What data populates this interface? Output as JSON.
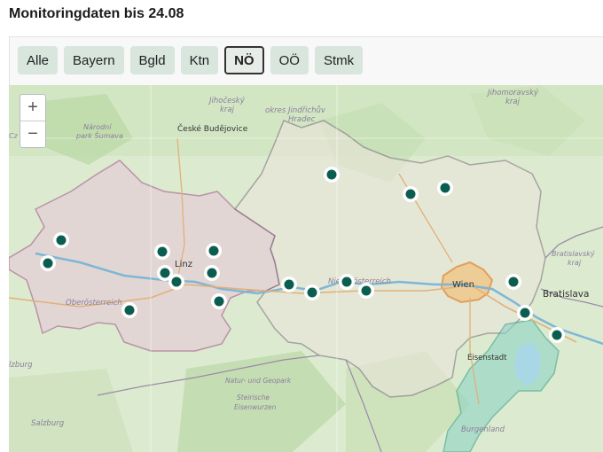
{
  "title": "Monitoringdaten bis 24.08",
  "filters": [
    {
      "label": "Alle",
      "active": false
    },
    {
      "label": "Bayern",
      "active": false
    },
    {
      "label": "Bgld",
      "active": false
    },
    {
      "label": "Ktn",
      "active": false
    },
    {
      "label": "NÖ",
      "active": true
    },
    {
      "label": "OÖ",
      "active": false
    },
    {
      "label": "Stmk",
      "active": false
    }
  ],
  "zoom": {
    "in": "+",
    "out": "−"
  },
  "map_labels": {
    "jihocesky": "Jihočeský",
    "kraj1": "kraj",
    "okres": "okres Jindřichův",
    "hradec": "Hradec",
    "budejovice": "České Budějovice",
    "jihomoravsky": "Jihomoravský",
    "kraj2": "kraj",
    "narodni": "Národní",
    "park": "park Šumava",
    "linz": "Linz",
    "oberoesterreich": "Oberösterreich",
    "niederoesterreich": "Niederösterreich",
    "wien": "Wien",
    "bratislava": "Bratislava",
    "bratislavsky": "Bratislavský",
    "kraj3": "kraj",
    "eisenstadt": "Eisenstadt",
    "burgenland": "Burgenland",
    "naturpark1": "Natur- und Geopark",
    "naturpark2": "Steirische",
    "naturpark3": "Eisenwurzen",
    "salzburg": "Salzburg",
    "salzburg_cut": "lzburg",
    "cz": "Cz"
  },
  "marker_count": 21,
  "colors": {
    "marker": "#0b5e4f",
    "wien": "#f3c27a",
    "burgenland": "#8fd3c4"
  }
}
